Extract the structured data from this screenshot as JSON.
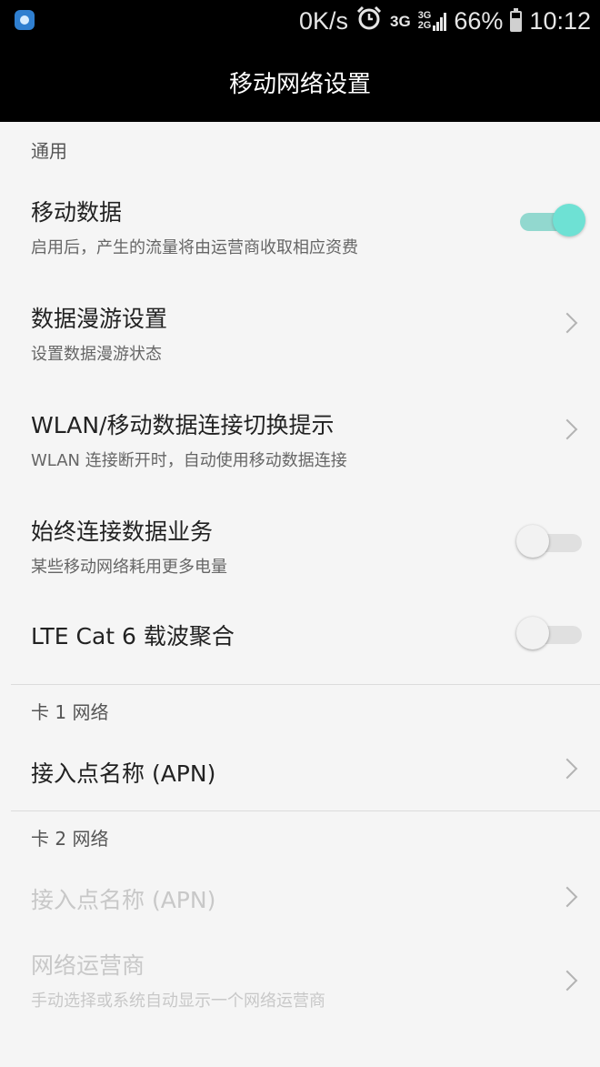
{
  "status_bar": {
    "speed": "0K/s",
    "icons": [
      "app-notification-icon",
      "alarm-clock-icon",
      "3g-signal-icon",
      "3g-2g-signal-icon",
      "battery-icon"
    ],
    "network_primary": "3G",
    "network_secondary_top": "3G",
    "network_secondary_bottom": "2G",
    "battery_percent": "66%",
    "battery_level": 0.66,
    "time": "10:12"
  },
  "header": {
    "title": "移动网络设置"
  },
  "sections": {
    "general": {
      "label": "通用",
      "mobile_data": {
        "title": "移动数据",
        "subtitle": "启用后，产生的流量将由运营商收取相应资费",
        "enabled": true
      },
      "roaming": {
        "title": "数据漫游设置",
        "subtitle": "设置数据漫游状态"
      },
      "wlan_switch": {
        "title": "WLAN/移动数据连接切换提示",
        "subtitle": "WLAN 连接断开时，自动使用移动数据连接"
      },
      "always_on": {
        "title": "始终连接数据业务",
        "subtitle": "某些移动网络耗用更多电量",
        "enabled": false
      },
      "lte_ca": {
        "title": "LTE Cat 6 载波聚合",
        "enabled": false
      }
    },
    "sim1": {
      "label": "卡 1 网络",
      "apn": {
        "title": "接入点名称 (APN)"
      }
    },
    "sim2": {
      "label": "卡 2 网络",
      "apn": {
        "title": "接入点名称 (APN)",
        "disabled": true
      },
      "operator": {
        "title": "网络运营商",
        "subtitle": "手动选择或系统自动显示一个网络运营商",
        "disabled": true
      }
    }
  },
  "colors": {
    "accent": "#6ee1d4",
    "accent_track": "#92d8cf",
    "header_bg": "#000000",
    "page_bg": "#f5f5f5"
  }
}
